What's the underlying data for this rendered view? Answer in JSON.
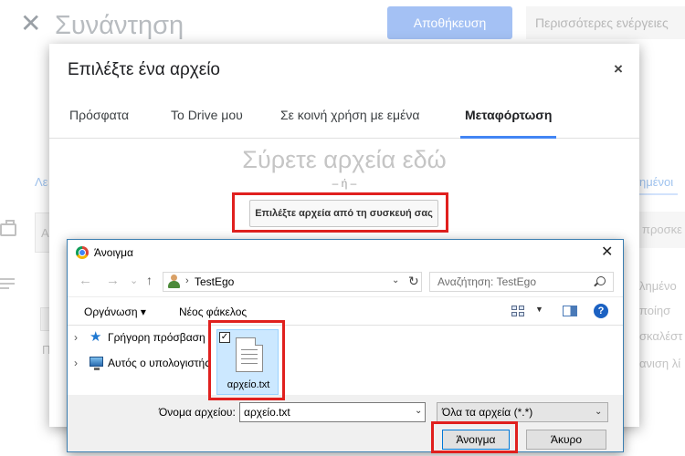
{
  "background": {
    "title": "Συνάντηση",
    "save_button": "Αποθήκευση",
    "more_actions": "Περισσότερες ενέργειες",
    "fragments": {
      "left_tab": "Λε",
      "right_tab": "ημένοι",
      "left_input": "Α",
      "right_input": "προσκε",
      "left_text": "Π",
      "right_1": "λημένο",
      "right_2": "ποίησ",
      "right_3": "σκαλέστ",
      "right_4": "ανιση λί"
    }
  },
  "picker": {
    "title": "Επιλέξτε ένα αρχείο",
    "close": "×",
    "tabs": [
      {
        "label": "Πρόσφατα"
      },
      {
        "label": "Το Drive μου"
      },
      {
        "label": "Σε κοινή χρήση με εμένα"
      },
      {
        "label": "Μεταφόρτωση"
      }
    ],
    "active_tab": 3,
    "drop_text": "Σύρετε αρχεία εδώ",
    "or_text": "– ή –",
    "select_button": "Επιλέξτε αρχεία από τη συσκευή σας"
  },
  "win_dialog": {
    "title": "Άνοιγμα",
    "close": "✕",
    "back": "←",
    "forward": "→",
    "recent": "⌄",
    "up": "↑",
    "address_sep": "›",
    "address": "TestEgo",
    "address_dropdown": "⌄",
    "refresh": "↻",
    "search_placeholder": "Αναζήτηση: TestEgo",
    "organize": "Οργάνωση ▾",
    "new_folder": "Νέος φάκελος",
    "view_dropdown": "▼",
    "help": "?",
    "nav_items": [
      {
        "chev": "›",
        "label": "Γρήγορη πρόσβαση"
      },
      {
        "chev": "›",
        "label": "Αυτός ο υπολογιστής"
      }
    ],
    "file": {
      "name": "αρχείο.txt",
      "checked": "✓"
    },
    "filename_label": "Όνομα αρχείου:",
    "filename_value": "αρχείο.txt",
    "filename_dropdown": "⌄",
    "filter": "Όλα τα αρχεία (*.*)",
    "filter_dropdown": "⌄",
    "open_button": "Άνοιγμα",
    "cancel_button": "Άκυρο"
  },
  "colors": {
    "highlight": "#e0201e",
    "google_blue": "#4285f4",
    "windows_accent": "#0078d7"
  }
}
